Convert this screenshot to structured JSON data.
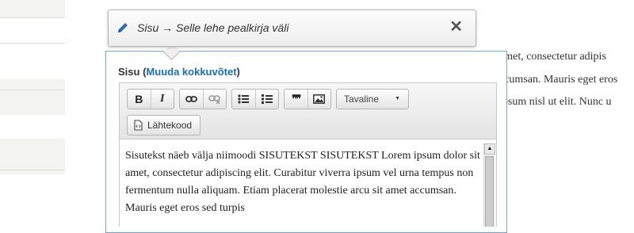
{
  "tooltip": {
    "text": "Sisu → Selle lehe pealkirja väli",
    "close": "✕"
  },
  "field": {
    "label": "Sisu",
    "open_paren": " (",
    "summary_link": "Muuda kokkuvõtet",
    "close_paren": ")"
  },
  "toolbar": {
    "bold": "B",
    "italic": "I",
    "blockquote": "❞❞",
    "format_select": "Tavaline",
    "source_button": "Lähtekood"
  },
  "content": {
    "text": "Sisutekst näeb välja niimoodi SISUTEKST SISUTEKST Lorem ipsum dolor sit amet, consectetur adipiscing elit. Curabitur viverra ipsum vel urna tempus non fermentum nulla aliquam. Etiam placerat molestie arcu sit amet accumsan. Mauris eget eros sed turpis"
  },
  "background": {
    "lines": [
      "amet, consectetur adipis",
      "ccumsan. Mauris eget eros",
      "ipsum nisl ut elit. Nunc u"
    ]
  }
}
